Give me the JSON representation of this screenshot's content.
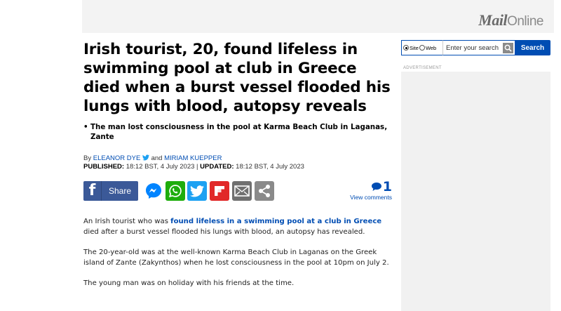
{
  "header": {
    "logo_mail": "Mail",
    "logo_online": "Online"
  },
  "article": {
    "headline": "Irish tourist, 20, found lifeless in swimming pool at club in Greece died when a burst vessel flooded his lungs with blood, autopsy reveals",
    "bullets": [
      "The man lost consciousness in the pool at Karma Beach Club in Laganas, Zante"
    ],
    "byline": {
      "prefix": "By ",
      "author1": "ELEANOR DYE",
      "and": " and ",
      "author2": "MIRIAM KUEPPER"
    },
    "dates": {
      "published_label": "PUBLISHED:",
      "published_value": " 18:12 BST, 4 July 2023 | ",
      "updated_label": "UPDATED:",
      "updated_value": " 18:12 BST, 4 July 2023"
    },
    "share": {
      "facebook_label": "Share",
      "facebook_glyph": "f"
    },
    "comments": {
      "count": "1",
      "label": "View comments"
    },
    "paragraph1": {
      "before": "An Irish tourist who was ",
      "link": "found lifeless in a swimming pool at a club in Greece",
      "after": " died after a burst vessel flooded his lungs with blood, an autopsy has revealed."
    },
    "paragraph2": "The 20-year-old was at the well-known Karma Beach Club in Laganas on the Greek island of Zante (Zakynthos) when he lost consciousness in the pool at 10pm on July 2.",
    "paragraph3": "The young man was on holiday with his friends at the time."
  },
  "search": {
    "option_site": "Site",
    "option_web": "Web",
    "placeholder": "Enter your search",
    "button": "Search"
  },
  "ad": {
    "label": "ADVERTISEMENT"
  },
  "colors": {
    "link": "#004db3",
    "facebook": "#3b5998",
    "whatsapp": "#1ead0c",
    "twitter": "#1da1f2",
    "flipboard": "#e12828"
  }
}
